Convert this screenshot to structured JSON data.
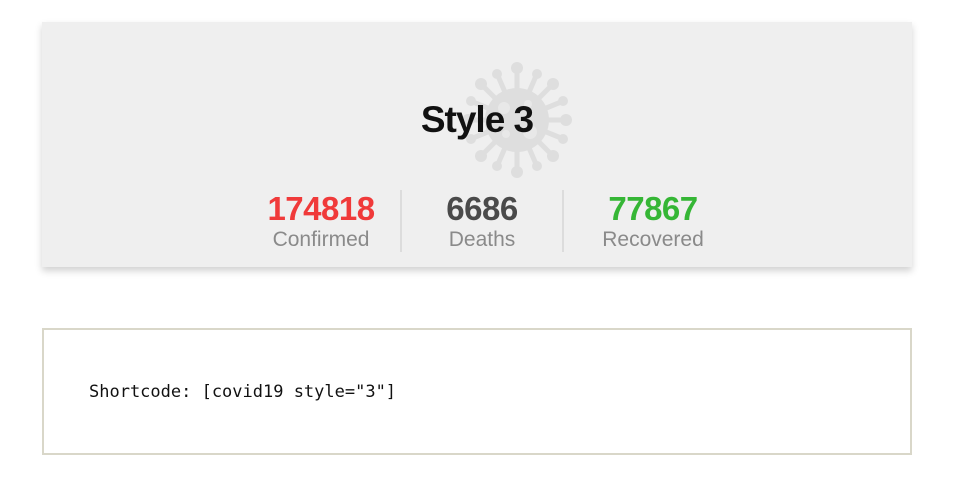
{
  "widget": {
    "title": "Style 3",
    "icon": "coronavirus-icon",
    "stats": [
      {
        "value": "174818",
        "label": "Confirmed",
        "color": "#f03a3a"
      },
      {
        "value": "6686",
        "label": "Deaths",
        "color": "#4a4a4a"
      },
      {
        "value": "77867",
        "label": "Recovered",
        "color": "#35b635"
      }
    ]
  },
  "code": {
    "text": "Shortcode: [covid19 style=\"3\"]"
  }
}
